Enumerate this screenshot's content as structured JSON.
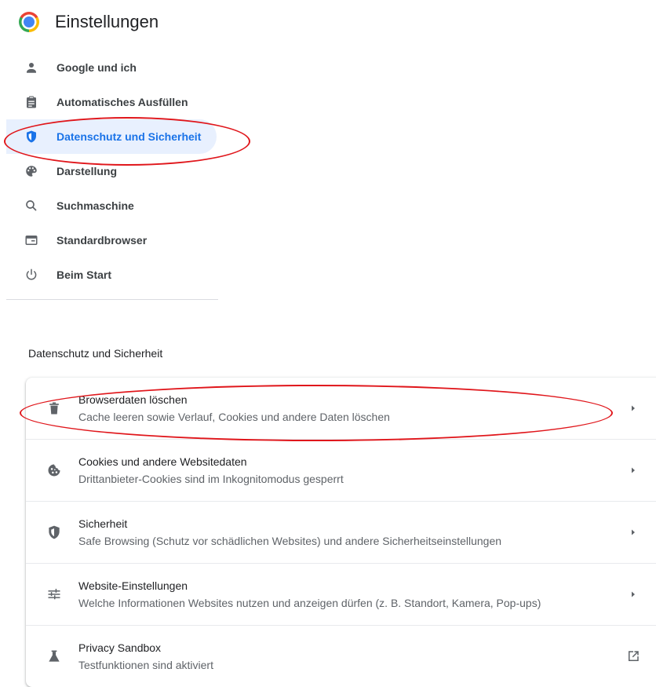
{
  "app": {
    "title": "Einstellungen",
    "logo_icon": "chrome-logo-icon"
  },
  "nav": {
    "items": [
      {
        "label": "Google und ich",
        "icon": "person-icon",
        "active": false
      },
      {
        "label": "Automatisches Ausfüllen",
        "icon": "clipboard-icon",
        "active": false
      },
      {
        "label": "Datenschutz und Sicherheit",
        "icon": "shield-icon",
        "active": true
      },
      {
        "label": "Darstellung",
        "icon": "palette-icon",
        "active": false
      },
      {
        "label": "Suchmaschine",
        "icon": "search-icon",
        "active": false
      },
      {
        "label": "Standardbrowser",
        "icon": "browser-window-icon",
        "active": false
      },
      {
        "label": "Beim Start",
        "icon": "power-icon",
        "active": false
      }
    ]
  },
  "section": {
    "title": "Datenschutz und Sicherheit",
    "rows": [
      {
        "title": "Browserdaten löschen",
        "description": "Cache leeren sowie Verlauf, Cookies und andere Daten löschen",
        "icon": "trash-icon",
        "action_icon": "chevron-right-icon"
      },
      {
        "title": "Cookies und andere Websitedaten",
        "description": "Drittanbieter-Cookies sind im Inkognitomodus gesperrt",
        "icon": "cookie-icon",
        "action_icon": "chevron-right-icon"
      },
      {
        "title": "Sicherheit",
        "description": "Safe Browsing (Schutz vor schädlichen Websites) und andere Sicherheitseinstellungen",
        "icon": "security-shield-icon",
        "action_icon": "chevron-right-icon"
      },
      {
        "title": "Website-Einstellungen",
        "description": "Welche Informationen Websites nutzen und anzeigen dürfen (z. B. Standort, Kamera, Pop-ups)",
        "icon": "tune-icon",
        "action_icon": "chevron-right-icon"
      },
      {
        "title": "Privacy Sandbox",
        "description": "Testfunktionen sind aktiviert",
        "icon": "flask-icon",
        "action_icon": "open-in-new-icon"
      }
    ]
  },
  "colors": {
    "accent": "#1a73e8",
    "active_bg": "#e8f0fe",
    "annotation": "#e0161b"
  }
}
